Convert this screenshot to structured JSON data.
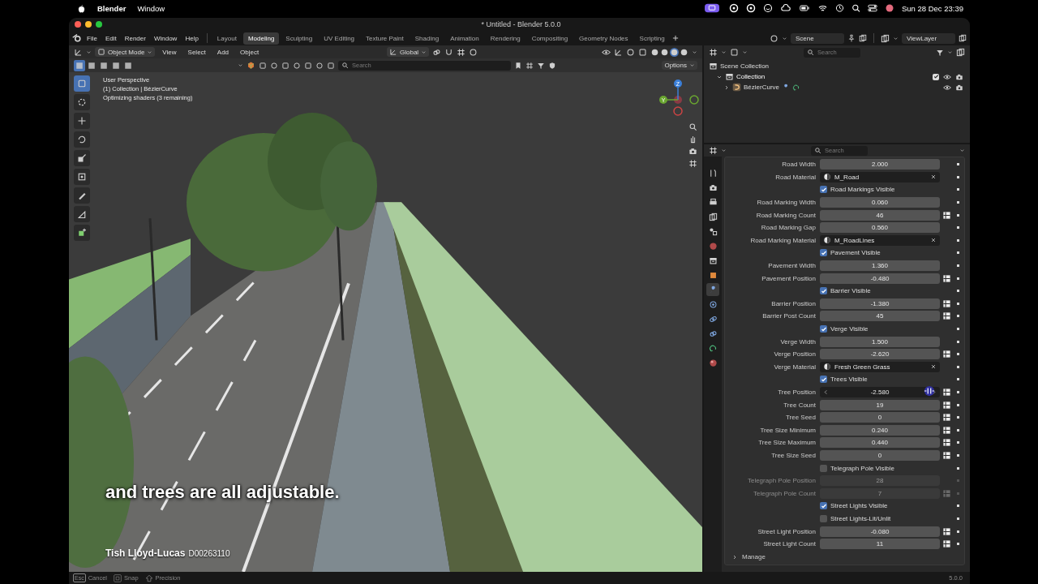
{
  "menubar": {
    "app": "Blender",
    "menus": [
      "Window"
    ],
    "status_icons": [
      {
        "kind": "screen"
      },
      {
        "kind": "ring"
      },
      {
        "kind": "ring"
      },
      {
        "kind": "smiley"
      },
      {
        "kind": "cloud"
      },
      {
        "kind": "battery"
      },
      {
        "kind": "wifi"
      },
      {
        "kind": "clock"
      },
      {
        "kind": "search"
      },
      {
        "kind": "toggles"
      },
      {
        "kind": "avatar"
      }
    ],
    "clock": "Sun 28 Dec  23:39"
  },
  "window": {
    "title": "* Untitled - Blender 5.0.0"
  },
  "topbar": {
    "menus": [
      "File",
      "Edit",
      "Render",
      "Window",
      "Help"
    ],
    "workspaces": [
      {
        "label": "Layout",
        "selected": false
      },
      {
        "label": "Modeling",
        "selected": true
      },
      {
        "label": "Sculpting",
        "selected": false
      },
      {
        "label": "UV Editing",
        "selected": false
      },
      {
        "label": "Texture Paint",
        "selected": false
      },
      {
        "label": "Shading",
        "selected": false
      },
      {
        "label": "Animation",
        "selected": false
      },
      {
        "label": "Rendering",
        "selected": false
      },
      {
        "label": "Compositing",
        "selected": false
      },
      {
        "label": "Geometry Nodes",
        "selected": false
      },
      {
        "label": "Scripting",
        "selected": false
      }
    ],
    "scene": "Scene",
    "view_layer": "ViewLayer"
  },
  "viewport": {
    "mode": "Object Mode",
    "menus": [
      "View",
      "Select",
      "Add",
      "Object"
    ],
    "orientation": "Global",
    "shading": [
      {
        "selected": false
      },
      {
        "selected": false
      },
      {
        "selected": true
      },
      {
        "selected": false
      }
    ],
    "select_modes": [
      {
        "selected": true
      },
      {
        "selected": false
      },
      {
        "selected": false
      },
      {
        "selected": false
      },
      {
        "selected": false
      }
    ],
    "search": {
      "placeholder": "Search"
    },
    "options": "Options",
    "overlay_lines": [
      "User Perspective",
      "(1) Collection | BézierCurve",
      "Optimizing shaders (3 remaining)"
    ],
    "tools": [
      {
        "kind": "select",
        "selected": true
      },
      {
        "kind": "cursor",
        "selected": false
      },
      {
        "kind": "move",
        "selected": false
      },
      {
        "kind": "rotate",
        "selected": false
      },
      {
        "kind": "scale",
        "selected": false
      },
      {
        "kind": "transform",
        "selected": false
      },
      {
        "kind": "annotate",
        "selected": false
      },
      {
        "kind": "measure",
        "selected": false
      },
      {
        "kind": "add",
        "selected": false
      }
    ],
    "axes": [
      {
        "label": "Z",
        "color": "#3b7fd8"
      },
      {
        "label": "Y",
        "color": "#6aa630"
      }
    ],
    "caption": "and trees are all adjustable.",
    "credit": {
      "name": "Tish Lloyd-Lucas",
      "id": "D00263110"
    }
  },
  "outliner": {
    "search": {
      "placeholder": "Search"
    },
    "tree": [
      {
        "label": "Scene Collection",
        "kind": "scene",
        "children": [
          {
            "label": "Collection",
            "kind": "collection",
            "expanded": true,
            "checked": true,
            "children": [
              {
                "label": "BézierCurve",
                "kind": "curve",
                "expanded": false
              }
            ]
          }
        ]
      }
    ]
  },
  "properties": {
    "search": {
      "placeholder": "Search"
    },
    "tabs": [
      {
        "kind": "tool",
        "selected": false
      },
      {
        "kind": "render",
        "selected": false
      },
      {
        "kind": "output",
        "selected": false
      },
      {
        "kind": "view",
        "selected": false
      },
      {
        "kind": "scene",
        "selected": false
      },
      {
        "kind": "world",
        "selected": false
      },
      {
        "kind": "collection",
        "selected": false
      },
      {
        "kind": "object",
        "selected": false
      },
      {
        "kind": "modifier",
        "selected": true
      },
      {
        "kind": "particles",
        "selected": false
      },
      {
        "kind": "physics",
        "selected": false
      },
      {
        "kind": "constraint",
        "selected": false
      },
      {
        "kind": "data",
        "selected": false
      },
      {
        "kind": "material",
        "selected": false
      }
    ],
    "rows": [
      {
        "kind": "number",
        "label": "Road Width",
        "value": "2.000",
        "toggle": false,
        "active": false,
        "disabled": false
      },
      {
        "kind": "material",
        "label": "Road Material",
        "value": "M_Road",
        "disabled": false
      },
      {
        "kind": "checkbox",
        "label": "Road Markings Visible",
        "checked": true,
        "disabled": false
      },
      {
        "kind": "number",
        "label": "Road Marking Width",
        "value": "0.060",
        "toggle": false,
        "active": false,
        "disabled": false
      },
      {
        "kind": "number",
        "label": "Road Marking Count",
        "value": "46",
        "toggle": true,
        "active": false,
        "disabled": false
      },
      {
        "kind": "number",
        "label": "Road Marking Gap",
        "value": "0.560",
        "toggle": false,
        "active": false,
        "disabled": false
      },
      {
        "kind": "material",
        "label": "Road Marking Material",
        "value": "M_RoadLines",
        "disabled": false
      },
      {
        "kind": "checkbox",
        "label": "Pavement Visible",
        "checked": true,
        "disabled": false
      },
      {
        "kind": "number",
        "label": "Pavement Width",
        "value": "1.360",
        "toggle": false,
        "active": false,
        "disabled": false
      },
      {
        "kind": "number",
        "label": "Pavement Position",
        "value": "-0.480",
        "toggle": true,
        "active": false,
        "disabled": false
      },
      {
        "kind": "checkbox",
        "label": "Barrier Visible",
        "checked": true,
        "disabled": false
      },
      {
        "kind": "number",
        "label": "Barrier Position",
        "value": "-1.380",
        "toggle": true,
        "active": false,
        "disabled": false
      },
      {
        "kind": "number",
        "label": "Barrier Post Count",
        "value": "45",
        "toggle": true,
        "active": false,
        "disabled": false
      },
      {
        "kind": "checkbox",
        "label": "Verge Visible",
        "checked": true,
        "disabled": false
      },
      {
        "kind": "number",
        "label": "Verge Width",
        "value": "1.500",
        "toggle": false,
        "active": false,
        "disabled": false
      },
      {
        "kind": "number",
        "label": "Verge Position",
        "value": "-2.620",
        "toggle": true,
        "active": false,
        "disabled": false
      },
      {
        "kind": "material",
        "label": "Verge Material",
        "value": "Fresh Green Grass",
        "disabled": false
      },
      {
        "kind": "checkbox",
        "label": "Trees Visible",
        "checked": true,
        "disabled": false
      },
      {
        "kind": "number",
        "label": "Tree Position",
        "value": "-2.580",
        "toggle": true,
        "active": true,
        "disabled": false
      },
      {
        "kind": "number",
        "label": "Tree Count",
        "value": "19",
        "toggle": true,
        "active": false,
        "disabled": false
      },
      {
        "kind": "number",
        "label": "Tree Seed",
        "value": "0",
        "toggle": true,
        "active": false,
        "disabled": false
      },
      {
        "kind": "number",
        "label": "Tree Size Minimum",
        "value": "0.240",
        "toggle": true,
        "active": false,
        "disabled": false
      },
      {
        "kind": "number",
        "label": "Tree Size Maximum",
        "value": "0.440",
        "toggle": true,
        "active": false,
        "disabled": false
      },
      {
        "kind": "number",
        "label": "Tree Size Seed",
        "value": "0",
        "toggle": true,
        "active": false,
        "disabled": false
      },
      {
        "kind": "checkbox",
        "label": "Telegraph Pole Visible",
        "checked": false,
        "disabled": false
      },
      {
        "kind": "number",
        "label": "Telegraph Pole Position",
        "value": "28",
        "toggle": false,
        "active": false,
        "disabled": true
      },
      {
        "kind": "number",
        "label": "Telegraph Pole Count",
        "value": "7",
        "toggle": true,
        "active": false,
        "disabled": true
      },
      {
        "kind": "checkbox",
        "label": "Street Lights Visible",
        "checked": true,
        "disabled": false
      },
      {
        "kind": "checkbox",
        "label": "Street Lights-Lit/Unlit",
        "checked": false,
        "disabled": false
      },
      {
        "kind": "number",
        "label": "Street Light Position",
        "value": "-0.080",
        "toggle": true,
        "active": false,
        "disabled": false
      },
      {
        "kind": "number",
        "label": "Street Light Count",
        "value": "11",
        "toggle": true,
        "active": false,
        "disabled": false
      }
    ],
    "manage": {
      "label": "Manage",
      "expanded": false
    }
  },
  "status_bar": {
    "hints": [
      {
        "kind": "key",
        "key": "Esc",
        "label": "Cancel"
      },
      {
        "kind": "command",
        "label": "Snap"
      },
      {
        "kind": "shift",
        "label": "Precision"
      }
    ],
    "version": "5.0.0"
  }
}
